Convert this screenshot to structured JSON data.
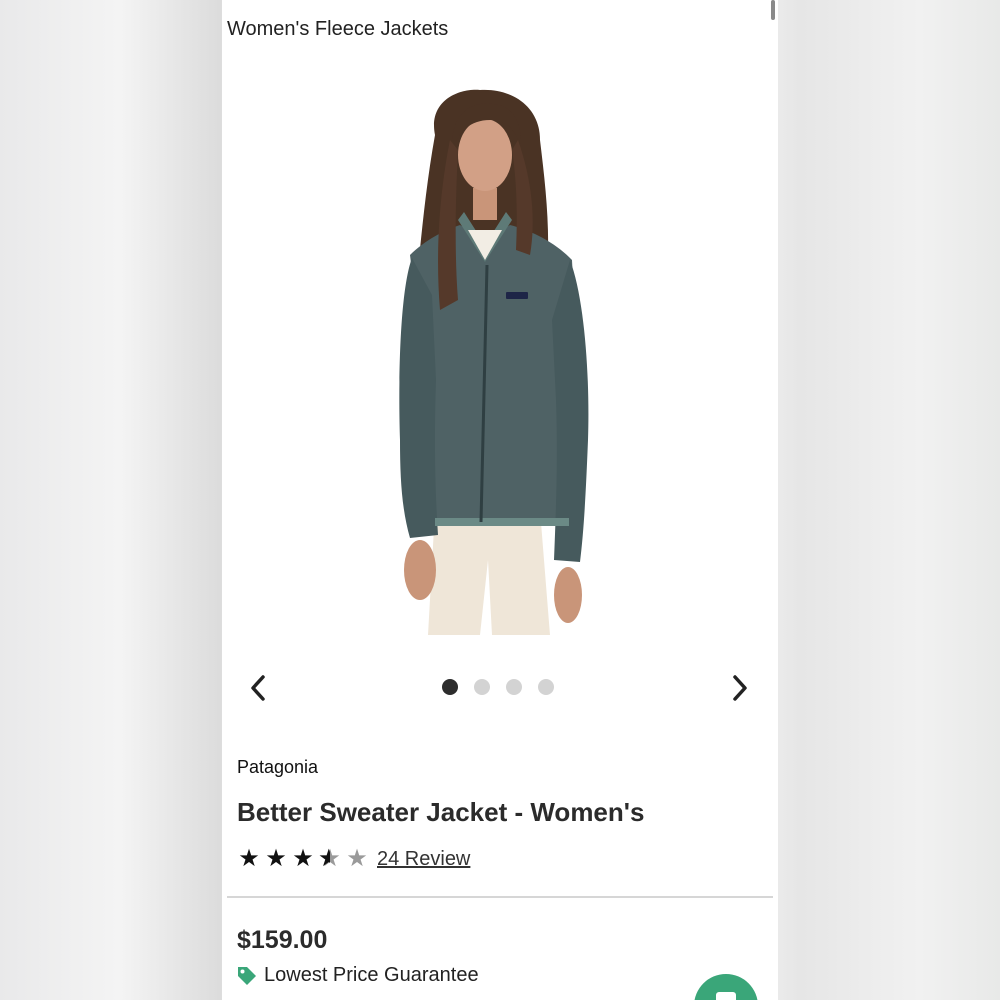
{
  "page": {
    "category_title": "Women's Fleece Jackets"
  },
  "carousel": {
    "prev_icon": "chevron-left-icon",
    "next_icon": "chevron-right-icon",
    "slide_count": 4,
    "active_index": 0
  },
  "product": {
    "brand": "Patagonia",
    "title": "Better Sweater Jacket - Women's",
    "rating": 3.5,
    "rating_max": 5,
    "reviews_label": "24 Review",
    "price": "$159.00",
    "guarantee_label": "Lowest Price Guarantee",
    "guarantee_icon": "price-tag-icon"
  },
  "colors": {
    "accent_green": "#3aa679",
    "jacket": "#4d5f62"
  }
}
